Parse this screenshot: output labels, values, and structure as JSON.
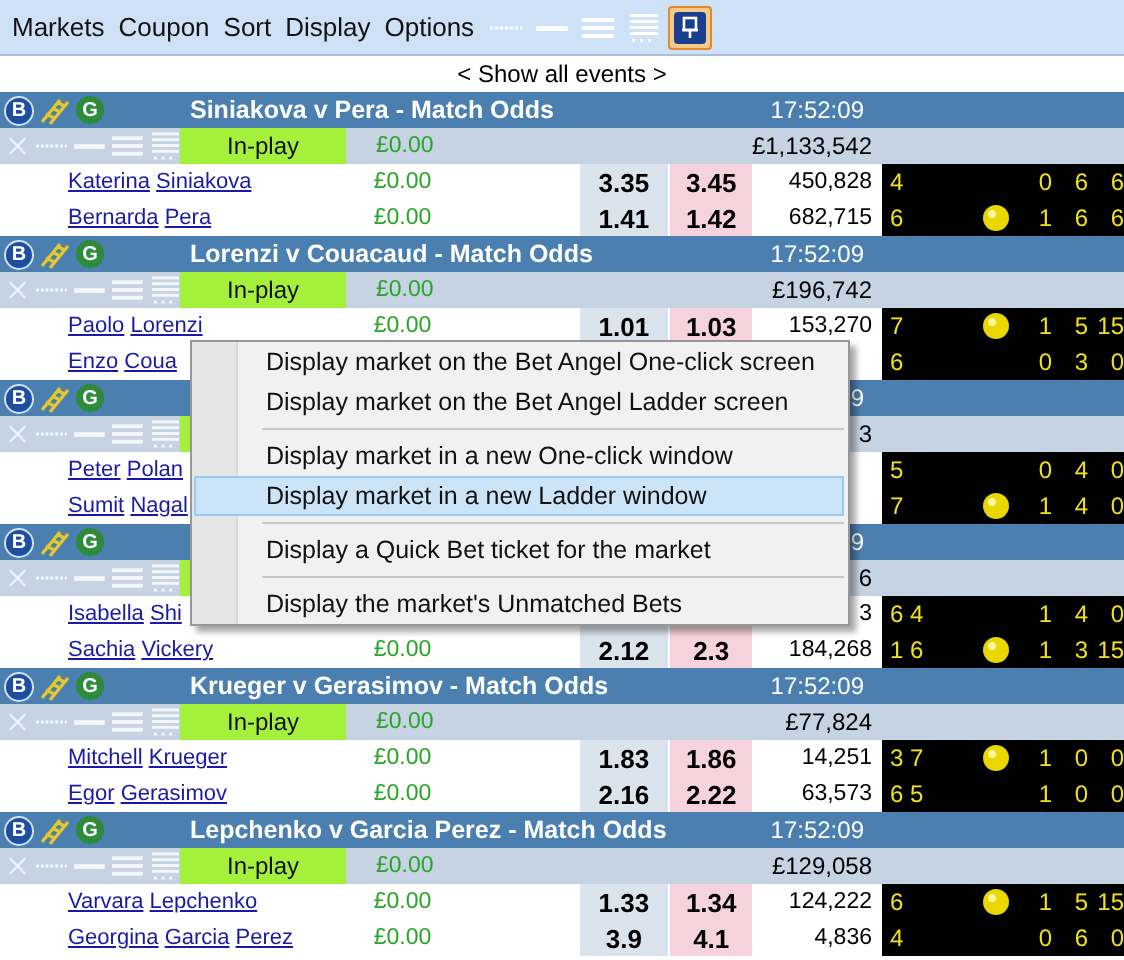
{
  "toolbar": {
    "menus": [
      "Markets",
      "Coupon",
      "Sort",
      "Display",
      "Options"
    ],
    "view_buttons": [
      {
        "kind": "dotted",
        "selected": false
      },
      {
        "kind": "single",
        "selected": false
      },
      {
        "kind": "triple",
        "selected": false
      },
      {
        "kind": "grid",
        "selected": false
      },
      {
        "kind": "pin",
        "selected": true
      }
    ]
  },
  "show_all": "< Show all events >",
  "markets": [
    {
      "badge_left": "B",
      "badge_right": "G",
      "title": "Siniakova v Pera - Match Odds",
      "time": "17:52:09",
      "in_play": true,
      "status": "In-play",
      "matched": "£0.00",
      "total": "£1,133,542",
      "runners": [
        {
          "name": "Katerina Siniakova",
          "matched": "£0.00",
          "back": "3.35",
          "lay": "3.45",
          "volume": "450,828",
          "sets": "4",
          "serving": false,
          "score": [
            "0",
            "6",
            "6"
          ]
        },
        {
          "name": "Bernarda Pera",
          "matched": "£0.00",
          "back": "1.41",
          "lay": "1.42",
          "volume": "682,715",
          "sets": "6",
          "serving": true,
          "score": [
            "1",
            "6",
            "6"
          ]
        }
      ]
    },
    {
      "badge_left": "B",
      "badge_right": "G",
      "title": "Lorenzi v Couacaud - Match Odds",
      "time": "17:52:09",
      "in_play": true,
      "status": "In-play",
      "matched": "£0.00",
      "total": "£196,742",
      "runners": [
        {
          "name": "Paolo Lorenzi",
          "matched": "£0.00",
          "back": "1.01",
          "lay": "1.03",
          "volume": "153,270",
          "sets": "7",
          "serving": true,
          "score": [
            "1",
            "5",
            "15"
          ]
        },
        {
          "name": "Enzo Coua",
          "sets": "6",
          "serving": false,
          "score": [
            "0",
            "3",
            "0"
          ]
        }
      ]
    },
    {
      "badge_left": "B",
      "badge_right": "G",
      "time": "9",
      "in_play": true,
      "total": "3",
      "runners": [
        {
          "name": "Peter Polan",
          "sets": "5",
          "serving": false,
          "score": [
            "0",
            "4",
            "0"
          ]
        },
        {
          "name": "Sumit Nagal",
          "sets": "7",
          "serving": true,
          "score": [
            "1",
            "4",
            "0"
          ]
        }
      ]
    },
    {
      "badge_left": "B",
      "badge_right": "G",
      "time": "9",
      "in_play": true,
      "total": "6",
      "runners": [
        {
          "name": "Isabella Shi",
          "volume": "3",
          "sets": "6 4",
          "serving": false,
          "score": [
            "1",
            "4",
            "0"
          ]
        },
        {
          "name": "Sachia Vickery",
          "matched": "£0.00",
          "back": "2.12",
          "lay": "2.3",
          "volume": "184,268",
          "sets": "1 6",
          "serving": true,
          "score": [
            "1",
            "3",
            "15"
          ]
        }
      ]
    },
    {
      "badge_left": "B",
      "badge_right": "G",
      "title": "Krueger v Gerasimov - Match Odds",
      "time": "17:52:09",
      "in_play": true,
      "status": "In-play",
      "matched": "£0.00",
      "total": "£77,824",
      "runners": [
        {
          "name": "Mitchell Krueger",
          "matched": "£0.00",
          "back": "1.83",
          "lay": "1.86",
          "volume": "14,251",
          "sets": "3 7",
          "serving": true,
          "score": [
            "1",
            "0",
            "0"
          ]
        },
        {
          "name": "Egor Gerasimov",
          "matched": "£0.00",
          "back": "2.16",
          "lay": "2.22",
          "volume": "63,573",
          "sets": "6 5",
          "serving": false,
          "score": [
            "1",
            "0",
            "0"
          ]
        }
      ]
    },
    {
      "badge_left": "B",
      "badge_right": "G",
      "title": "Lepchenko v Garcia Perez - Match Odds",
      "time": "17:52:09",
      "in_play": true,
      "status": "In-play",
      "matched": "£0.00",
      "total": "£129,058",
      "runners": [
        {
          "name": "Varvara Lepchenko",
          "matched": "£0.00",
          "back": "1.33",
          "lay": "1.34",
          "volume": "124,222",
          "sets": "6",
          "serving": true,
          "score": [
            "1",
            "5",
            "15"
          ]
        },
        {
          "name": "Georgina Garcia Perez",
          "matched": "£0.00",
          "back": "3.9",
          "lay": "4.1",
          "volume": "4,836",
          "sets": "4",
          "serving": false,
          "score": [
            "0",
            "6",
            "0"
          ]
        }
      ]
    }
  ],
  "context_menu": {
    "groups": [
      [
        {
          "label": "Display market on the Bet Angel One-click screen",
          "selected": false
        },
        {
          "label": "Display market on the Bet Angel Ladder screen",
          "selected": false
        }
      ],
      [
        {
          "label": "Display market in a new One-click window",
          "selected": false
        },
        {
          "label": "Display market in a new Ladder window",
          "selected": true
        }
      ],
      [
        {
          "label": "Display a Quick Bet ticket for the market",
          "selected": false
        }
      ],
      [
        {
          "label": "Display the market's Unmatched Bets",
          "selected": false
        }
      ]
    ]
  }
}
